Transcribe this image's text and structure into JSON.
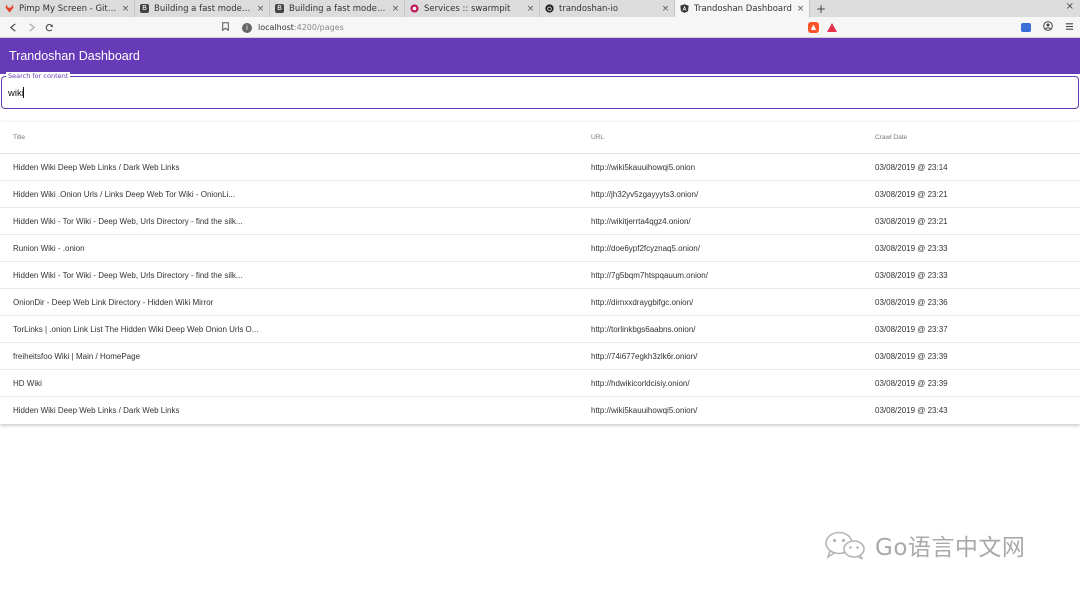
{
  "browser": {
    "tabs": [
      {
        "label": "Pimp My Screen - GitLab",
        "icon": "gitlab-icon",
        "active": false
      },
      {
        "label": "Building a fast modern web",
        "icon": "page-icon",
        "active": false
      },
      {
        "label": "Building a fast modern web",
        "icon": "page-icon",
        "active": false
      },
      {
        "label": "Services :: swarmpit",
        "icon": "swarmpit-icon",
        "active": false
      },
      {
        "label": "trandoshan-io",
        "icon": "github-icon",
        "active": false
      },
      {
        "label": "Trandoshan Dashboard",
        "icon": "angular-icon",
        "active": true
      }
    ],
    "new_tab_symbol": "+",
    "close_symbol": "×",
    "url_host": "localhost",
    "url_path": ":4200/pages"
  },
  "app": {
    "title": "Trandoshan Dashboard",
    "accent_color": "#673ab7"
  },
  "search": {
    "label": "Search for content",
    "value": "wiki"
  },
  "table": {
    "headers": {
      "title": "Title",
      "url": "URL",
      "date": "Crawl Date"
    },
    "rows": [
      {
        "title": "Hidden Wiki Deep Web Links / Dark Web Links",
        "url": "http://wiki5kauuihowqi5.onion",
        "date": "03/08/2019 @ 23:14"
      },
      {
        "title": "Hidden Wiki .Onion Urls / Links Deep Web Tor Wiki - OnionLi...",
        "url": "http://jh32yv5zgayyyts3.onion/",
        "date": "03/08/2019 @ 23:21"
      },
      {
        "title": "Hidden Wiki - Tor Wiki - Deep Web, Urls Directory - find the silk...",
        "url": "http://wikitjerrta4qgz4.onion/",
        "date": "03/08/2019 @ 23:21"
      },
      {
        "title": "Runion Wiki - .onion",
        "url": "http://doe6ypf2fcyznaq5.onion/",
        "date": "03/08/2019 @ 23:33"
      },
      {
        "title": "Hidden Wiki - Tor Wiki - Deep Web, Urls Directory - find the silk...",
        "url": "http://7g5bqm7htspqauum.onion/",
        "date": "03/08/2019 @ 23:33"
      },
      {
        "title": "OnionDir - Deep Web Link Directory - Hidden Wiki Mirror",
        "url": "http://dirnxxdraygbifgc.onion/",
        "date": "03/08/2019 @ 23:36"
      },
      {
        "title": "TorLinks | .onion Link List The Hidden Wiki Deep Web Onion Urls O...",
        "url": "http://torlinkbgs6aabns.onion/",
        "date": "03/08/2019 @ 23:37"
      },
      {
        "title": "freiheitsfoo Wiki | Main / HomePage",
        "url": "http://74i677egkh3zlk6r.onion/",
        "date": "03/08/2019 @ 23:39"
      },
      {
        "title": "HD Wiki",
        "url": "http://hdwikicorldcisiy.onion/",
        "date": "03/08/2019 @ 23:39"
      },
      {
        "title": "Hidden Wiki Deep Web Links / Dark Web Links",
        "url": "http://wiki5kauuihowqi5.onion/",
        "date": "03/08/2019 @ 23:43"
      }
    ]
  },
  "watermark": {
    "text": "Go语言中文网"
  }
}
